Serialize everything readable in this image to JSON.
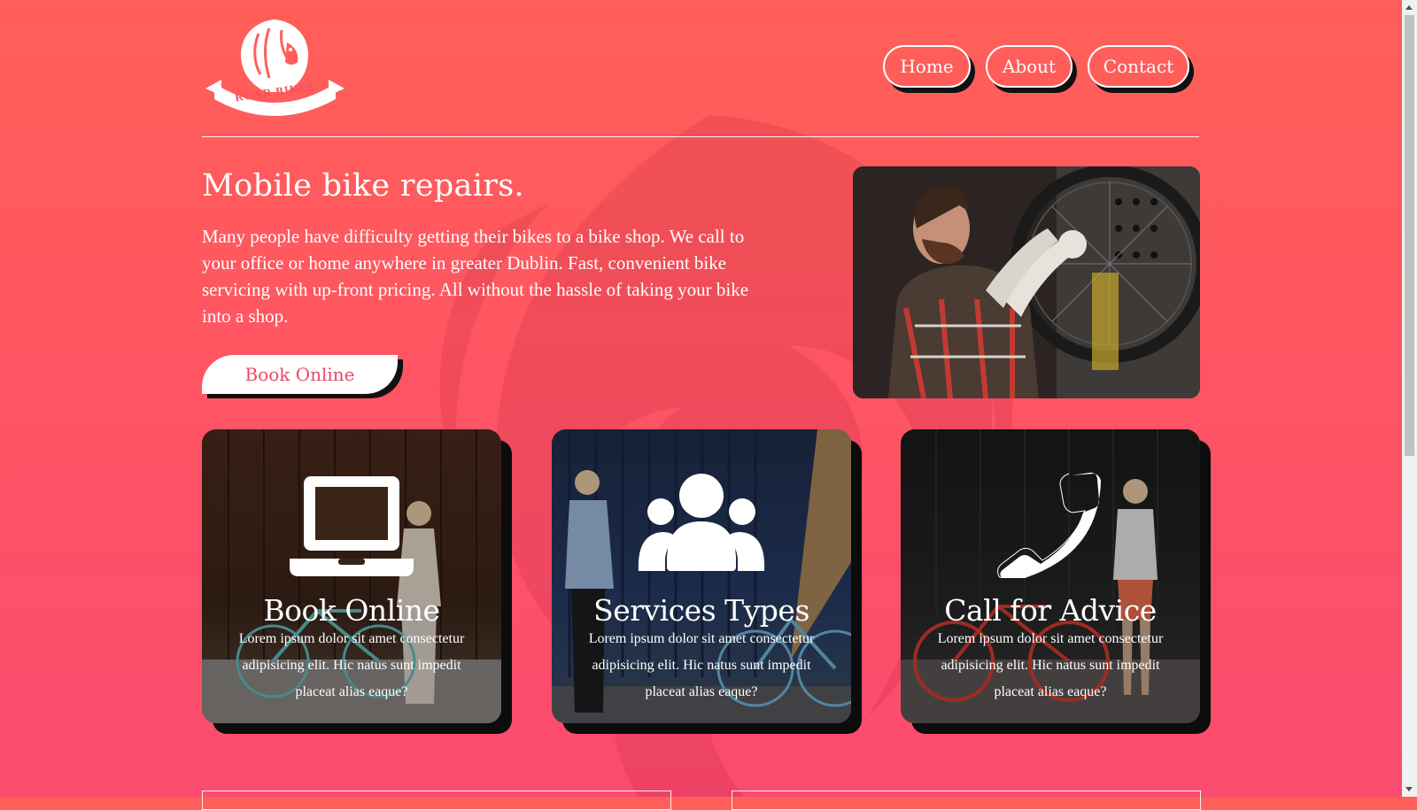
{
  "brand": {
    "logo_text": "ROAR BIKES"
  },
  "nav": {
    "items": [
      "Home",
      "About",
      "Contact"
    ]
  },
  "hero": {
    "title": "Mobile bike repairs.",
    "description": "Many people have difficulty getting their bikes to a bike shop. We call to your office or home anywhere in greater Dublin. Fast, convenient bike servicing with up-front pricing. All without the hassle of taking your bike into a shop.",
    "button_label": "Book Online"
  },
  "cards": [
    {
      "icon": "laptop-icon",
      "title": "Book Online",
      "text": "Lorem ipsum dolor sit amet consectetur adipisicing elit. Hic natus sunt impedit placeat alias eaque?"
    },
    {
      "icon": "users-icon",
      "title": "Services Types",
      "text": "Lorem ipsum dolor sit amet consectetur adipisicing elit. Hic natus sunt impedit placeat alias eaque?"
    },
    {
      "icon": "phone-icon",
      "title": "Call for Advice",
      "text": "Lorem ipsum dolor sit amet consectetur adipisicing elit. Hic natus sunt impedit placeat alias eaque?"
    }
  ],
  "colors": {
    "accent": "#e84a66",
    "shadow": "#111111",
    "background_top": "#ff5f58",
    "background_bottom": "#fb4b6f"
  }
}
